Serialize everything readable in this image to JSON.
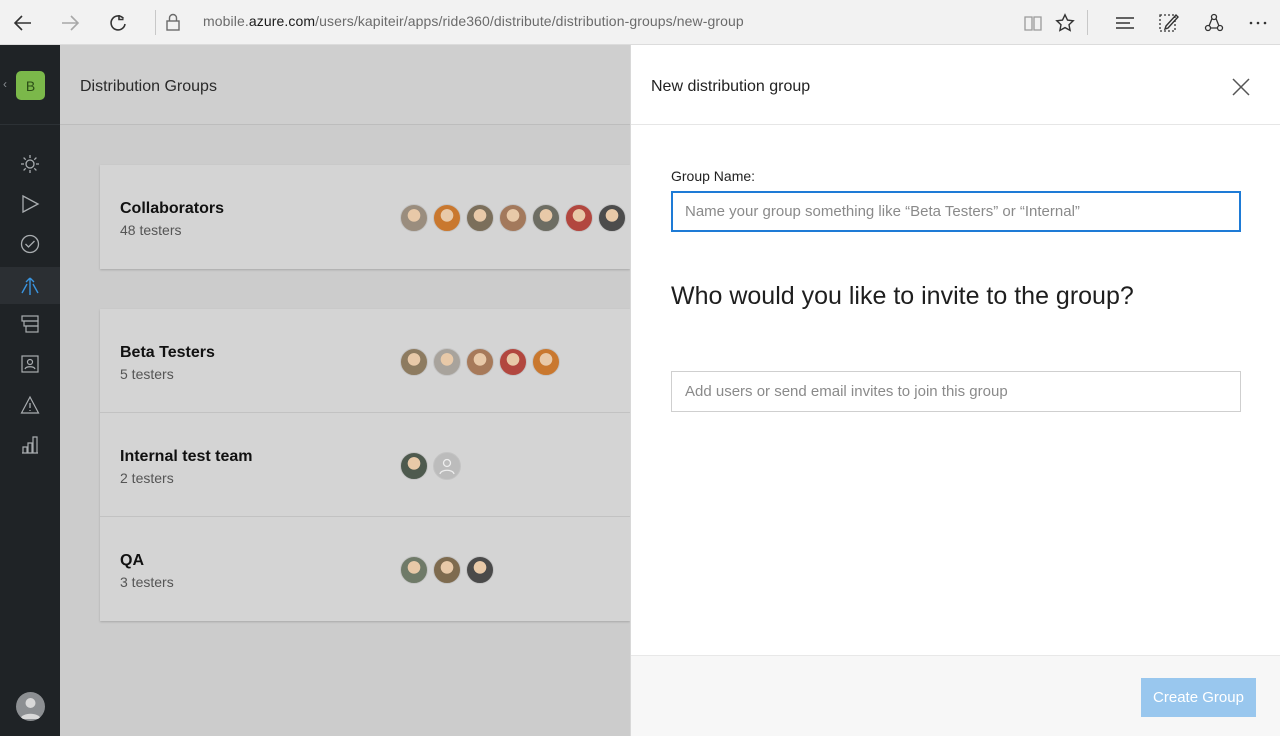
{
  "browser": {
    "url_prefix": "mobile.",
    "url_domain": "azure.com",
    "url_path": "/users/kapiteir/apps/ride360/distribute/distribution-groups/new-group"
  },
  "rail": {
    "app_badge": "B"
  },
  "main": {
    "title": "Distribution Groups",
    "groups": [
      {
        "name": "Collaborators",
        "count": "48 testers",
        "avatar_colors": [
          "#9a8d7e",
          "#c9782f",
          "#7b6f5b",
          "#a3795c",
          "#6d6d63",
          "#b2473f",
          "#4c4c4c"
        ]
      },
      {
        "name": "Beta Testers",
        "count": "5 testers",
        "avatar_colors": [
          "#8d7b60",
          "#a8a39c",
          "#a77a5a",
          "#b2473f",
          "#c9782f"
        ]
      },
      {
        "name": "Internal test team",
        "count": "2 testers",
        "avatar_colors": [
          "#4e5a4e"
        ]
      },
      {
        "name": "QA",
        "count": "3 testers",
        "avatar_colors": [
          "#6f7a68",
          "#7e6b4f",
          "#4a4a4a"
        ]
      }
    ]
  },
  "panel": {
    "title": "New distribution group",
    "group_name_label": "Group Name:",
    "group_name_placeholder": "Name your group something like “Beta Testers” or “Internal”",
    "group_name_value": "",
    "invite_heading": "Who would you like to invite to the group?",
    "invite_placeholder": "Add users or send email invites to join this group",
    "invite_value": "",
    "create_button": "Create Group"
  },
  "colors": {
    "accent": "#1e7bd6",
    "button_disabled": "#99c7ee",
    "rail_bg": "#1f2326",
    "app_badge": "#7bb84a",
    "rail_active_icon": "#3a95e0"
  }
}
